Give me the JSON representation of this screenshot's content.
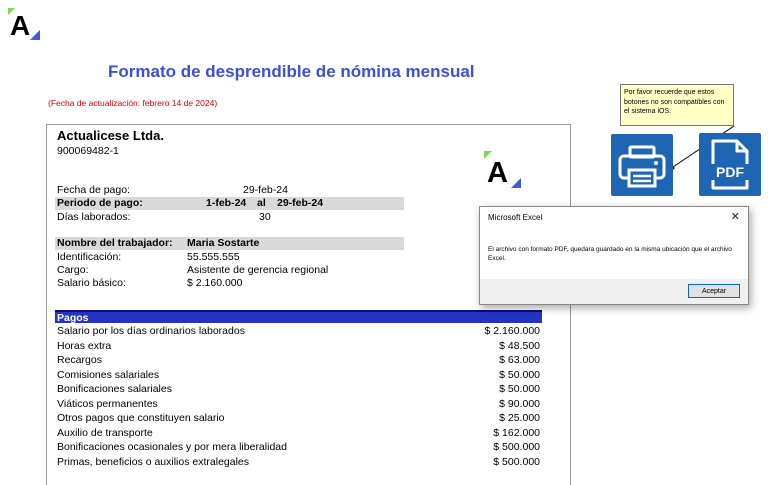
{
  "header": {
    "title": "Formato de desprendible de nómina mensual",
    "update_note": "(Fecha de actualización: febrero 14 de 2024)"
  },
  "company": {
    "name": "Actualicese Ltda.",
    "nit": "900069482-1"
  },
  "payment": {
    "fecha_label": "Fecha de pago:",
    "fecha_value": "29-feb-24",
    "periodo_label": "Periodo de pago:",
    "periodo_from": "1-feb-24",
    "periodo_sep": "al",
    "periodo_to": "29-feb-24",
    "dias_label": "Días laborados:",
    "dias_value": "30"
  },
  "worker": {
    "nombre_label": "Nombre del trabajador:",
    "nombre_value": "Maria Sostarte",
    "id_label": "Identificación:",
    "id_value": "55.555.555",
    "cargo_label": "Cargo:",
    "cargo_value": "Asistente de gerencia regional",
    "salario_label": "Salario básico:",
    "salario_value": "$ 2.160.000"
  },
  "pagos": {
    "heading": "Pagos",
    "rows": [
      {
        "label": "Salario por los días ordinarios laborados",
        "value": "$ 2.160.000"
      },
      {
        "label": "Horas extra",
        "value": "$ 48.500"
      },
      {
        "label": "Recargos",
        "value": "$ 63.000"
      },
      {
        "label": "Comisiones salariales",
        "value": "$ 50.000"
      },
      {
        "label": "Bonificaciones salariales",
        "value": "$ 50.000"
      },
      {
        "label": "Viáticos permanentes",
        "value": "$ 90.000"
      },
      {
        "label": "Otros pagos que constituyen salario",
        "value": "$ 25.000"
      },
      {
        "label": "Auxilio de transporte",
        "value": "$ 162.000"
      },
      {
        "label": "Bonificaciones ocasionales y por mera liberalidad",
        "value": "$ 500.000"
      },
      {
        "label": "Primas, beneficios o auxilios extralegales",
        "value": "$ 500.000"
      }
    ]
  },
  "note": {
    "text": "Por favor recuerde que estos botones no son compatibles con el sistema iOS."
  },
  "buttons": {
    "print_icon": "printer-icon",
    "pdf_label": "PDF"
  },
  "dialog": {
    "title": "Microsoft Excel",
    "close": "✕",
    "message": "El archivo con formato PDF, quedara guardado en la misma ubicación que el archivo Excel.",
    "ok_label": "Aceptar"
  },
  "colors": {
    "accent_blue": "#3c4fd9",
    "header_bar": "#2433c4",
    "button_blue": "#1e66b4",
    "note_bg": "#ffffc6",
    "logo_green": "#7ed957",
    "logo_blue": "#3c5bdc"
  }
}
